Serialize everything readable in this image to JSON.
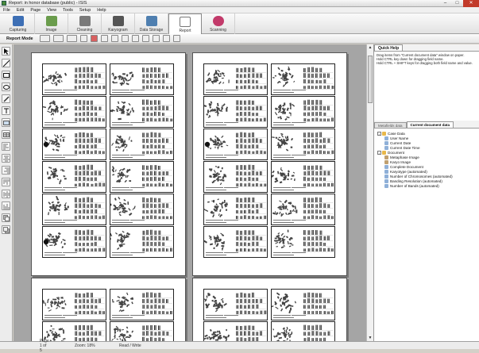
{
  "window": {
    "title": "Report: in honor database (public) - ISIS"
  },
  "menu": [
    "File",
    "Edit",
    "Page",
    "View",
    "Tools",
    "Setup",
    "Help"
  ],
  "mode_tabs": [
    {
      "label": "Capturing",
      "icon": "camera-icon",
      "color": "#3d6fb5"
    },
    {
      "label": "Image",
      "icon": "chromosome-image-icon",
      "color": "#6a9c4c"
    },
    {
      "label": "Cleaning",
      "icon": "cleaning-icon",
      "color": "#7a7a7a"
    },
    {
      "label": "Karyogram",
      "icon": "karyogram-icon",
      "color": "#555555"
    },
    {
      "label": "Data Storage",
      "icon": "database-icon",
      "color": "#4f7fb0"
    },
    {
      "label": "Report",
      "icon": "report-icon",
      "color": "#d9d9d9"
    },
    {
      "label": "Scanning",
      "icon": "scanning-gear-icon",
      "color": "#c23a6a"
    }
  ],
  "active_mode": "Report",
  "toolbar": {
    "mode_label": "Report Mode"
  },
  "quick_help": {
    "tab_label": "Quick Help",
    "lines": [
      "Drag items from \"Current document data\" window on paper.",
      "Hold CTRL key down for dragging field name.",
      "Hold CTRL + SHIFT keys for dragging both field name and value."
    ]
  },
  "doc_tabs": {
    "tab1": "Metafields data",
    "tab2": "Current document data"
  },
  "tree": [
    {
      "label": "Case Data",
      "level": 1,
      "expander": "-",
      "icon_color": "#e8b84a"
    },
    {
      "label": "User Name",
      "level": 2,
      "icon_color": "#8fb0d8"
    },
    {
      "label": "Current Date",
      "level": 2,
      "icon_color": "#8fb0d8"
    },
    {
      "label": "Current Date Time",
      "level": 2,
      "icon_color": "#8fb0d8"
    },
    {
      "label": "Document",
      "level": 1,
      "expander": "-",
      "icon_color": "#e8b84a"
    },
    {
      "label": "Metaphase Image",
      "level": 2,
      "icon_color": "#c0a070"
    },
    {
      "label": "Karyo Image",
      "level": 2,
      "icon_color": "#c0a070"
    },
    {
      "label": "Complete Document",
      "level": 2,
      "icon_color": "#8fb0d8"
    },
    {
      "label": "Karyotype (automated)",
      "level": 2,
      "icon_color": "#8fb0d8"
    },
    {
      "label": "Number of Chromosomes (automated)",
      "level": 2,
      "icon_color": "#8fb0d8"
    },
    {
      "label": "Banding Resolution (automated)",
      "level": 2,
      "icon_color": "#8fb0d8"
    },
    {
      "label": "Number of Bands (automated)",
      "level": 2,
      "icon_color": "#8fb0d8"
    }
  ],
  "status": {
    "page": "Page 1 of 5",
    "zoom": "Zoom: 18%",
    "mode": "Read / Write"
  }
}
